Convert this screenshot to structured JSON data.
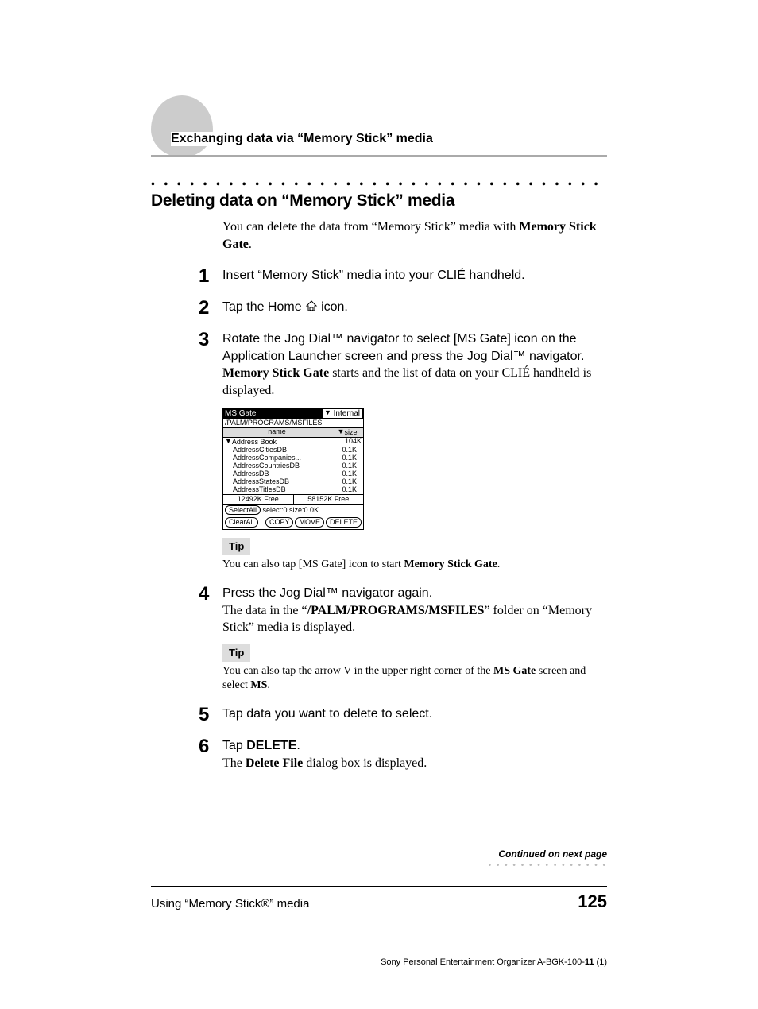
{
  "breadcrumb": "Exchanging data via “Memory Stick” media",
  "section_title": "Deleting data on “Memory Stick” media",
  "intro_pre": "You can delete the data from “Memory Stick” media with ",
  "intro_bold": "Memory Stick Gate",
  "intro_post": ".",
  "steps": {
    "s1": {
      "num": "1",
      "lead": "Insert “Memory Stick” media into your CLIÉ handheld."
    },
    "s2": {
      "num": "2",
      "lead_a": "Tap the Home ",
      "lead_b": " icon."
    },
    "s3": {
      "num": "3",
      "lead": "Rotate the Jog Dial™ navigator to select [MS Gate] icon on the Application Launcher screen and press the Jog Dial™ navigator.",
      "follow_bold": "Memory Stick Gate",
      "follow_rest": " starts and the list of data on your CLIÉ handheld is displayed."
    },
    "s4": {
      "num": "4",
      "lead": "Press the Jog Dial™ navigator again.",
      "follow_a": "The data in the “",
      "follow_bold": "/PALM/PROGRAMS/MSFILES",
      "follow_b": "” folder on “Memory Stick” media is displayed."
    },
    "s5": {
      "num": "5",
      "lead": "Tap data you want to delete to select."
    },
    "s6": {
      "num": "6",
      "lead_a": "Tap ",
      "lead_bold": "DELETE",
      "lead_b": ".",
      "follow_a": "The ",
      "follow_bold": "Delete File",
      "follow_b": " dialog box is displayed."
    }
  },
  "tip_label": "Tip",
  "tip1_a": "You can also tap [MS Gate] icon to start ",
  "tip1_bold": "Memory Stick Gate",
  "tip1_b": ".",
  "tip2_a": "You can also tap the arrow V in the upper right corner of the ",
  "tip2_bold1": "MS Gate",
  "tip2_b": " screen and select ",
  "tip2_bold2": "MS",
  "tip2_c": ".",
  "screenshot": {
    "title": "MS Gate",
    "mode": "Internal",
    "path": "/PALM/PROGRAMS/MSFILES",
    "col_name": "name",
    "col_size": "size",
    "category": "Address Book",
    "rows": [
      {
        "n": "AddressCitiesDB",
        "s": "0.1K"
      },
      {
        "n": "AddressCompanies...",
        "s": "0.1K"
      },
      {
        "n": "AddressCountriesDB",
        "s": "0.1K"
      },
      {
        "n": "AddressDB",
        "s": "0.1K"
      },
      {
        "n": "AddressStatesDB",
        "s": "0.1K"
      },
      {
        "n": "AddressTitlesDB",
        "s": "0.1K"
      }
    ],
    "cat_size": "104K",
    "free1": "12492K Free",
    "free2": "58152K Free",
    "sel": "select:0    size:0.0K",
    "btn_selectall": "SelectAll",
    "btn_clearall": "ClearAll",
    "btn_copy": "COPY",
    "btn_move": "MOVE",
    "btn_delete": "DELETE"
  },
  "continued": "Continued on next page",
  "footer_left": "Using “Memory Stick®” media",
  "page_number": "125",
  "subfooter_a": "Sony Personal Entertainment Organizer  A-BGK-100-",
  "subfooter_bold": "11",
  "subfooter_b": " (1)"
}
